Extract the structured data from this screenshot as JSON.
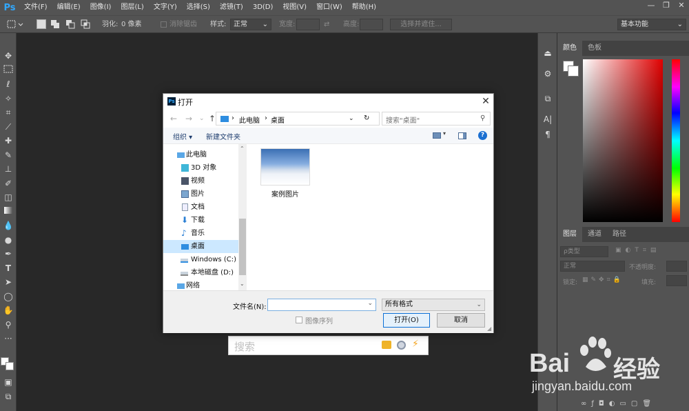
{
  "app": {
    "logo": "Ps",
    "menus": [
      "文件(F)",
      "编辑(E)",
      "图像(I)",
      "图层(L)",
      "文字(Y)",
      "选择(S)",
      "滤镜(T)",
      "3D(D)",
      "视图(V)",
      "窗口(W)",
      "帮助(H)"
    ],
    "window_controls": [
      "—",
      "❐",
      "✕"
    ]
  },
  "options_bar": {
    "feather_label": "羽化:",
    "feather_value": "0 像素",
    "antialias_label": "消除锯齿",
    "style_label": "样式:",
    "style_value": "正常",
    "width_label": "宽度:",
    "height_label": "高度:",
    "select_mask_button": "选择并遮住...",
    "workspace_value": "基本功能"
  },
  "color_panel": {
    "tabs": [
      "颜色",
      "色板"
    ]
  },
  "layers_panel": {
    "tabs": [
      "图层",
      "通道",
      "路径"
    ],
    "kind_placeholder": "ρ类型",
    "blend_mode": "正常",
    "opacity_label": "不透明度:",
    "lock_label": "锁定:",
    "fill_label": "填充:"
  },
  "dialog": {
    "title": "打开",
    "breadcrumb": [
      "此电脑",
      "桌面"
    ],
    "search_placeholder": "搜索\"桌面\"",
    "organize_label": "组织",
    "new_folder_label": "新建文件夹",
    "nav_items": [
      {
        "label": "此电脑",
        "icon": "computer-icon",
        "selected": false
      },
      {
        "label": "3D 对象",
        "icon": "cube-icon",
        "selected": false
      },
      {
        "label": "视频",
        "icon": "video-icon",
        "selected": false
      },
      {
        "label": "图片",
        "icon": "picture-icon",
        "selected": false
      },
      {
        "label": "文档",
        "icon": "document-icon",
        "selected": false
      },
      {
        "label": "下载",
        "icon": "download-icon",
        "selected": false
      },
      {
        "label": "音乐",
        "icon": "music-icon",
        "selected": false
      },
      {
        "label": "桌面",
        "icon": "desktop-icon",
        "selected": true
      },
      {
        "label": "Windows (C:)",
        "icon": "drive-icon",
        "selected": false
      },
      {
        "label": "本地磁盘 (D:)",
        "icon": "drive-icon",
        "selected": false
      },
      {
        "label": "网络",
        "icon": "network-icon",
        "selected": false
      }
    ],
    "files": [
      {
        "name": "案例图片"
      }
    ],
    "filename_label": "文件名(N):",
    "filename_value": "",
    "format_value": "所有格式",
    "image_sequence_label": "图像序列",
    "open_button": "打开(O)",
    "cancel_button": "取消"
  },
  "canvas_search": {
    "placeholder": "搜索"
  },
  "watermark": {
    "brand": "Bai",
    "brand_cn": "经验",
    "url": "jingyan.baidu.com"
  }
}
